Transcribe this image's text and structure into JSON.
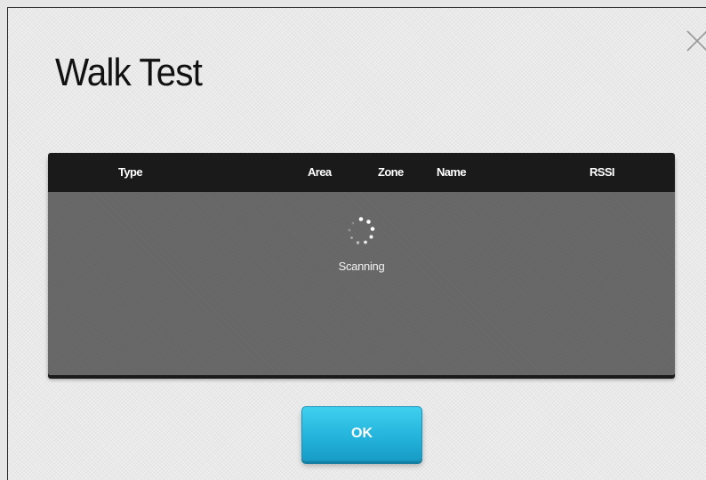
{
  "dialog": {
    "title": "Walk Test",
    "close_icon": "close-icon"
  },
  "table": {
    "columns": [
      "Type",
      "Area",
      "Zone",
      "Name",
      "RSSI"
    ],
    "rows": [],
    "status_text": "Scanning",
    "spinner_icon": "loading-spinner-icon"
  },
  "buttons": {
    "ok_label": "OK"
  },
  "colors": {
    "header_bg": "#1a1a1a",
    "body_bg": "#666666",
    "ok_button": "#24b4dc"
  }
}
